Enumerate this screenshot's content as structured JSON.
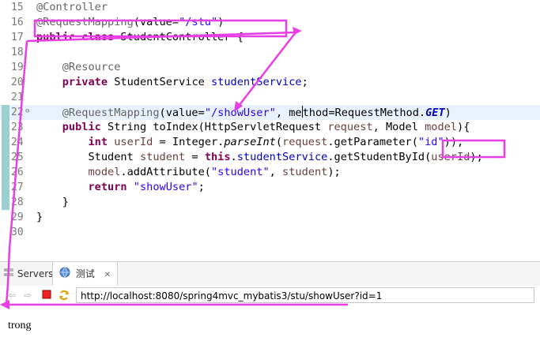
{
  "editor": {
    "lines": [
      {
        "n": "15",
        "fold": "",
        "changed": false,
        "hl": false,
        "tokens": [
          {
            "t": "@Controller",
            "c": "ann"
          }
        ]
      },
      {
        "n": "16",
        "fold": "",
        "changed": false,
        "hl": false,
        "tokens": [
          {
            "t": "@RequestMapping",
            "c": "ann"
          },
          {
            "t": "(value="
          },
          {
            "t": "\"/stu\"",
            "c": "str"
          },
          {
            "t": ")"
          }
        ]
      },
      {
        "n": "17",
        "fold": "",
        "changed": false,
        "hl": false,
        "tokens": [
          {
            "t": "public",
            "c": "kw"
          },
          {
            "t": " "
          },
          {
            "t": "class",
            "c": "kw"
          },
          {
            "t": " StudentController {"
          }
        ]
      },
      {
        "n": "18",
        "fold": "",
        "changed": false,
        "hl": false,
        "tokens": []
      },
      {
        "n": "19",
        "fold": "",
        "changed": false,
        "hl": false,
        "tokens": [
          {
            "t": "    "
          },
          {
            "t": "@Resource",
            "c": "ann"
          }
        ]
      },
      {
        "n": "20",
        "fold": "",
        "changed": false,
        "hl": false,
        "tokens": [
          {
            "t": "    "
          },
          {
            "t": "private",
            "c": "kw"
          },
          {
            "t": " StudentService "
          },
          {
            "t": "studentService",
            "c": "fld"
          },
          {
            "t": ";"
          }
        ]
      },
      {
        "n": "21",
        "fold": "",
        "changed": false,
        "hl": false,
        "tokens": []
      },
      {
        "n": "22",
        "fold": "⊖",
        "changed": true,
        "hl": true,
        "tokens": [
          {
            "t": "    "
          },
          {
            "t": "@RequestMapping",
            "c": "ann"
          },
          {
            "t": "(value="
          },
          {
            "t": "\"/showUser\"",
            "c": "str"
          },
          {
            "t": ", me"
          },
          {
            "t": "",
            "c": "cursor"
          },
          {
            "t": "thod=RequestMethod."
          },
          {
            "t": "GET",
            "c": "stf"
          },
          {
            "t": ")"
          }
        ]
      },
      {
        "n": "23",
        "fold": "",
        "changed": true,
        "hl": false,
        "tokens": [
          {
            "t": "    "
          },
          {
            "t": "public",
            "c": "kw"
          },
          {
            "t": " String toIndex(HttpServletRequest "
          },
          {
            "t": "request",
            "c": "var"
          },
          {
            "t": ", Model "
          },
          {
            "t": "model",
            "c": "var"
          },
          {
            "t": "){"
          }
        ]
      },
      {
        "n": "24",
        "fold": "",
        "changed": true,
        "hl": false,
        "tokens": [
          {
            "t": "        "
          },
          {
            "t": "int",
            "c": "kw"
          },
          {
            "t": " "
          },
          {
            "t": "userId",
            "c": "var"
          },
          {
            "t": " = Integer."
          },
          {
            "t": "parseInt",
            "c": "ital"
          },
          {
            "t": "("
          },
          {
            "t": "request",
            "c": "var"
          },
          {
            "t": ".getParameter("
          },
          {
            "t": "\"id\"",
            "c": "str"
          },
          {
            "t": "));"
          }
        ]
      },
      {
        "n": "25",
        "fold": "",
        "changed": true,
        "hl": false,
        "tokens": [
          {
            "t": "        Student "
          },
          {
            "t": "student",
            "c": "var"
          },
          {
            "t": " = "
          },
          {
            "t": "this",
            "c": "kw"
          },
          {
            "t": "."
          },
          {
            "t": "studentService",
            "c": "fld"
          },
          {
            "t": ".getStudentById("
          },
          {
            "t": "userId",
            "c": "var"
          },
          {
            "t": ");"
          }
        ]
      },
      {
        "n": "26",
        "fold": "",
        "changed": true,
        "hl": false,
        "tokens": [
          {
            "t": "        "
          },
          {
            "t": "model",
            "c": "var"
          },
          {
            "t": ".addAttribute("
          },
          {
            "t": "\"student\"",
            "c": "str"
          },
          {
            "t": ", "
          },
          {
            "t": "student",
            "c": "var"
          },
          {
            "t": ");"
          }
        ]
      },
      {
        "n": "27",
        "fold": "",
        "changed": true,
        "hl": false,
        "tokens": [
          {
            "t": "        "
          },
          {
            "t": "return",
            "c": "kw"
          },
          {
            "t": " "
          },
          {
            "t": "\"showUser\"",
            "c": "str"
          },
          {
            "t": ";"
          }
        ]
      },
      {
        "n": "28",
        "fold": "",
        "changed": true,
        "hl": false,
        "tokens": [
          {
            "t": "    }"
          }
        ]
      },
      {
        "n": "29",
        "fold": "",
        "changed": false,
        "hl": false,
        "tokens": [
          {
            "t": "}"
          }
        ]
      },
      {
        "n": "30",
        "fold": "",
        "changed": false,
        "hl": false,
        "tokens": []
      }
    ]
  },
  "tabs": {
    "servers_label": "Servers",
    "test_label": "测试",
    "close_glyph": "✕"
  },
  "browser": {
    "url": "http://localhost:8080/spring4mvc_mybatis3/stu/showUser?id=1",
    "output_text": "trong"
  },
  "annotation_color": "#e83ee6"
}
